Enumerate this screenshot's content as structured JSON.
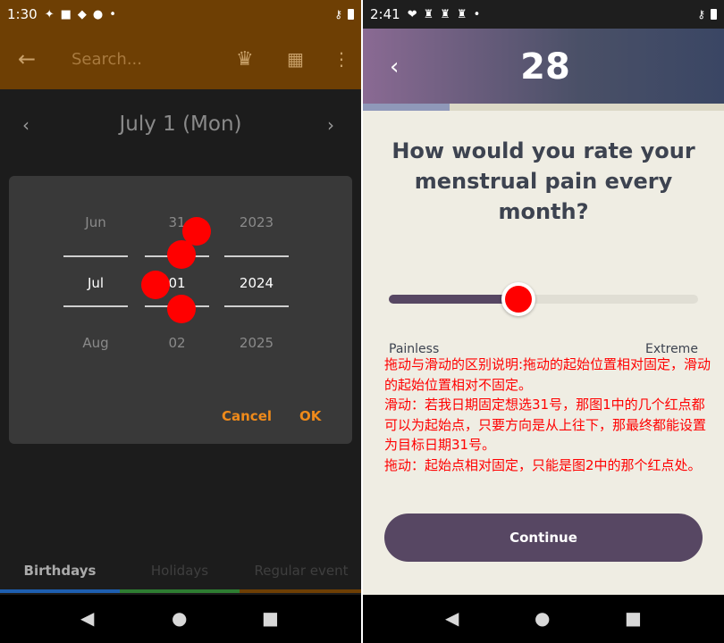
{
  "left": {
    "status": {
      "time": "1:30",
      "icons": [
        "hash-icon",
        "square-icon",
        "bell-icon",
        "paw-icon"
      ],
      "dot": "•"
    },
    "appbar": {
      "search_placeholder": "Search..."
    },
    "date_title": "July 1 (Mon)",
    "picker": {
      "months": [
        "Jun",
        "Jul",
        "Aug"
      ],
      "days": [
        "31",
        "01",
        "02"
      ],
      "years": [
        "2023",
        "2024",
        "2025"
      ],
      "cancel": "Cancel",
      "ok": "OK"
    },
    "tabs": [
      "Birthdays",
      "Holidays",
      "Regular event"
    ],
    "tab_colors": [
      "#1e5fb0",
      "#2e7d32",
      "#6e3f04"
    ],
    "accent": "#ef8a1a"
  },
  "right": {
    "status": {
      "time": "2:41",
      "icons": [
        "heart-icon",
        "chess-icon",
        "chess-icon",
        "chess-icon"
      ],
      "dot": "•"
    },
    "logo": "28",
    "progress": 0.24,
    "question": "How would you rate your menstrual pain every month?",
    "slider_value": 0.42,
    "min_label": "Painless",
    "max_label": "Extreme",
    "note": "拖动与滑动的区别说明:拖动的起始位置相对固定，滑动的起始位置相对不固定。\n滑动：若我日期固定想选31号，那图1中的几个红点都可以为起始点，只要方向是从上往下，那最终都能设置为目标日期31号。\n拖动：起始点相对固定，只能是图2中的那个红点处。",
    "continue": "Continue"
  }
}
